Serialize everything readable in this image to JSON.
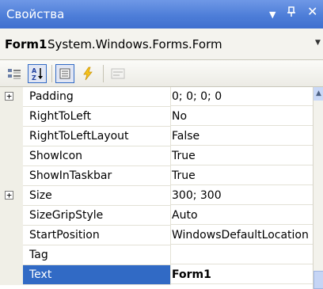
{
  "window": {
    "title": "Свойства",
    "dropdown_icon": "▼",
    "pin_icon": "ᵖ",
    "close_icon": "✕"
  },
  "object_selector": {
    "name": "Form1",
    "type": "System.Windows.Forms.Form"
  },
  "toolbar": {
    "buttons": [
      "categorized-icon",
      "alphabetical-icon",
      "properties-icon",
      "events-icon",
      "property-pages-icon"
    ]
  },
  "properties": [
    {
      "name": "Padding",
      "value": "0; 0; 0; 0",
      "expandable": true
    },
    {
      "name": "RightToLeft",
      "value": "No",
      "expandable": false
    },
    {
      "name": "RightToLeftLayout",
      "value": "False",
      "expandable": false
    },
    {
      "name": "ShowIcon",
      "value": "True",
      "expandable": false
    },
    {
      "name": "ShowInTaskbar",
      "value": "True",
      "expandable": false
    },
    {
      "name": "Size",
      "value": "300; 300",
      "expandable": true
    },
    {
      "name": "SizeGripStyle",
      "value": "Auto",
      "expandable": false
    },
    {
      "name": "StartPosition",
      "value": "WindowsDefaultLocation",
      "expandable": false
    },
    {
      "name": "Tag",
      "value": "",
      "expandable": false
    },
    {
      "name": "Text",
      "value": "Form1",
      "expandable": false,
      "selected": true
    }
  ],
  "colors": {
    "titlebar": "#4e7ed8",
    "selection": "#316ac5"
  }
}
